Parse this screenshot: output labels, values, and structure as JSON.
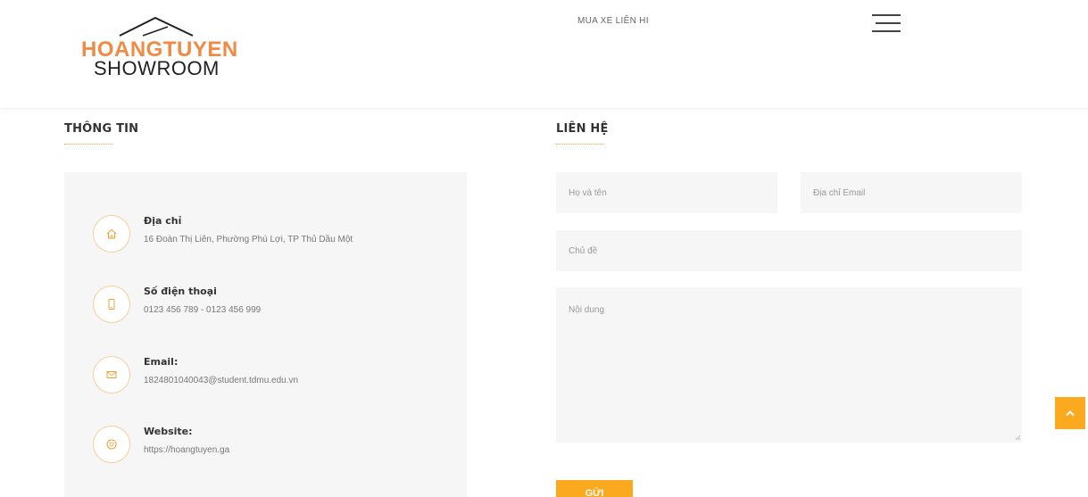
{
  "header": {
    "logo_line1": "HOANGTUYEN",
    "logo_line2": "SHOWROOM",
    "promo_text": "MUA XE LIÊN HI",
    "menu_icon": "hamburger-icon"
  },
  "info": {
    "title": "THÔNG TIN",
    "items": [
      {
        "icon": "home-icon",
        "label": "Địa chỉ",
        "value": "16 Đoàn Thị Liên, Phường Phú Lợi, TP Thủ Dầu Một"
      },
      {
        "icon": "phone-icon",
        "label": "Số điện thoại",
        "value": "0123 456 789 - 0123 456 999"
      },
      {
        "icon": "envelope-icon",
        "label": "Email:",
        "value": "1824801040043@student.tdmu.edu.vn"
      },
      {
        "icon": "globe-icon",
        "label": "Website:",
        "value": "https://hoangtuyen.ga"
      }
    ]
  },
  "contact": {
    "title": "LIÊN HỆ",
    "name_placeholder": "Họ và tên",
    "email_placeholder": "Địa chỉ Email",
    "subject_placeholder": "Chủ đề",
    "message_placeholder": "Nội dung",
    "submit_label": "GỬI"
  },
  "back_to_top_icon": "chevron-up-icon",
  "colors": {
    "accent": "#fbaa1f",
    "logo_orange": "#f08a44",
    "panel_bg": "#f6f6f6"
  }
}
